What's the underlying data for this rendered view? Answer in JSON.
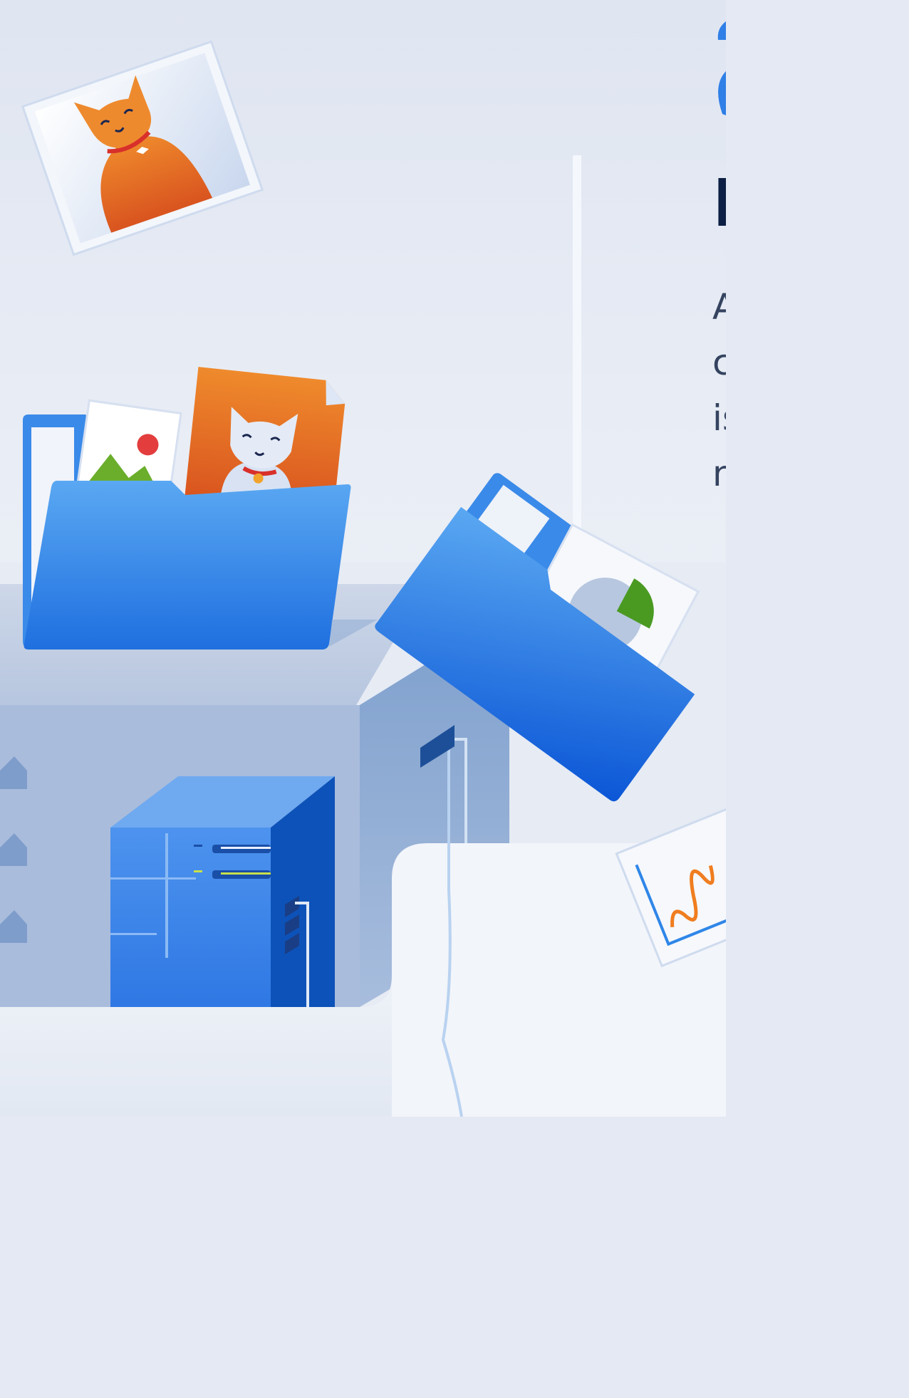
{
  "page": {
    "heading": "I",
    "body_lines": [
      "A",
      "c",
      "is",
      "n"
    ]
  },
  "colors": {
    "background": "#e4e9f3",
    "folder_blue": "#2f7fe6",
    "folder_dark": "#0d4fc7",
    "cat_orange": "#e0772a",
    "server_blue": "#3a86ea",
    "heading_navy": "#0d1f44"
  },
  "illustration": {
    "elements": [
      "orange-cat-photo",
      "open-folder-with-photos",
      "tilted-folder-with-pie-chart",
      "server-tower",
      "line-chart-card",
      "platform-blocks"
    ]
  }
}
